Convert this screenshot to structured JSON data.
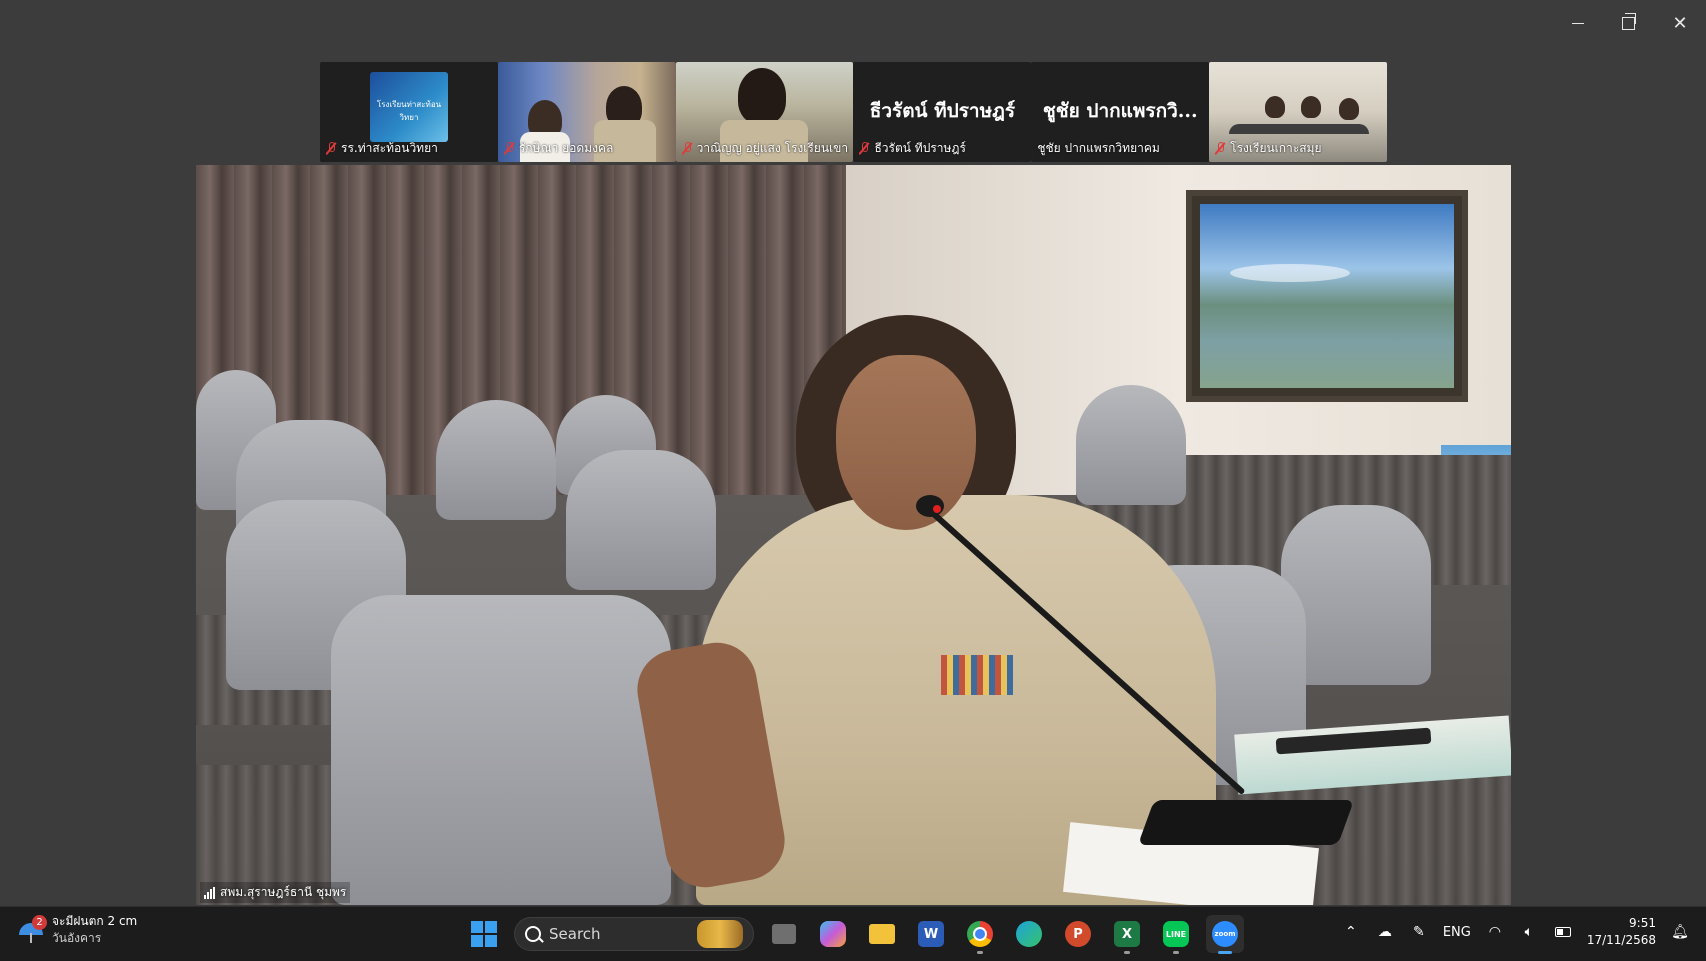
{
  "window": {
    "minimize_label": "minimize",
    "restore_label": "restore",
    "close_label": "close"
  },
  "participants": [
    {
      "name": "รร.ท่าสะท้อนวิทยา",
      "muted": true,
      "type": "logo",
      "logo_text": "โรงเรียนท่าสะท้อนวิทยา"
    },
    {
      "name": "รักษิณา ยอดมงคล",
      "muted": true,
      "type": "video"
    },
    {
      "name": "วาณิญญ อยู่แสง โรงเรียนเขา...",
      "muted": true,
      "type": "video"
    },
    {
      "name": "ธีวรัตน์ ทีปราษฎร์",
      "muted": true,
      "type": "name",
      "display": "ธีวรัตน์ ทีปราษฎร์"
    },
    {
      "name": "ชูชัย ปากแพรกวิทยาคม",
      "muted": false,
      "type": "name",
      "display": "ชูชัย ปากแพรกวิ..."
    },
    {
      "name": "โรงเรียนเกาะสมุย",
      "muted": true,
      "type": "video"
    }
  ],
  "main_video": {
    "speaker_label": "สพม.สุราษฎร์ธานี ชุมพร"
  },
  "taskbar": {
    "weather": {
      "badge": "2",
      "line1": "จะมีฝนตก 2 cm",
      "line2": "วันอังคาร"
    },
    "search_placeholder": "Search",
    "apps": [
      "Task View",
      "Copilot",
      "File Explorer",
      "Word",
      "Chrome",
      "Edge",
      "PowerPoint",
      "Excel",
      "LINE",
      "Zoom"
    ],
    "tray": {
      "language": "ENG",
      "time": "9:51",
      "date": "17/11/2568"
    }
  },
  "colors": {
    "background": "#3c3c3c",
    "taskbar": "#1c1c1c",
    "accent": "#4aa3f0",
    "muted_mic": "#e03a3a"
  }
}
